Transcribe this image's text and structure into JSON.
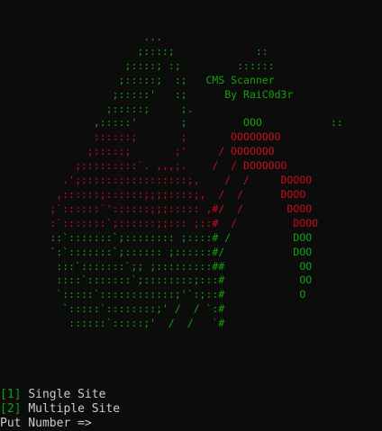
{
  "banner": {
    "title": "CMS Scanner",
    "author": "By RaiC0d3r",
    "art_lines": [
      [
        {
          "c": "g",
          "t": "                       ..."
        }
      ],
      [
        {
          "c": "g",
          "t": "                      ;::::;             ::"
        }
      ],
      [
        {
          "c": "g",
          "t": "                    ;::::; :;         ::::::"
        }
      ],
      [
        {
          "c": "g",
          "t": "                   ;:::::;  :;   "
        },
        {
          "c": "g",
          "t": "CMS Scanner"
        }
      ],
      [
        {
          "c": "g",
          "t": "                  ;:::::'   :;      "
        },
        {
          "c": "g",
          "t": "By RaiC0d3r"
        }
      ],
      [
        {
          "c": "g",
          "t": "                 ;:::::;     ;."
        }
      ],
      [
        {
          "c": "g",
          "t": "               ,:::::'       ;         OOO           ::"
        }
      ],
      [
        {
          "c": "r",
          "t": "               ::::::;       ;       OOOOOOOO"
        }
      ],
      [
        {
          "c": "r",
          "t": "              ;:::::;       ;'     / OOOOOOO"
        }
      ],
      [
        {
          "c": "r",
          "t": "            ;:::::::::`. ,,,;.    /  / DOOOOOO"
        }
      ],
      [
        {
          "c": "r",
          "t": "          .';:::::::::::::::::;,    /  /     DOOOO"
        }
      ],
      [
        {
          "c": "r",
          "t": "         ,::::::;::::::;;;;::::;,  /  /      DOOO"
        }
      ],
      [
        {
          "c": "r",
          "t": "        ;`::::::`'::::::;;;::::: ,#/  /       DOOO"
        }
      ],
      [
        {
          "c": "r",
          "t": "        :`:::::::`;::::::;;::: ;::#  /         DOOO"
        }
      ],
      [
        {
          "c": "g",
          "t": "        ::`:::::::`;:::::::: ;::::# /          DOO"
        }
      ],
      [
        {
          "c": "g",
          "t": "        `:`:::::::`;:::::: ;::::::#/           DOO"
        }
      ],
      [
        {
          "c": "g",
          "t": "         :::`:::::::`;; ;:::::::::##            OO"
        }
      ],
      [
        {
          "c": "g",
          "t": "         ::::`:::::::`;::::::::;:::#            OO"
        }
      ],
      [
        {
          "c": "g",
          "t": "         `:::::`::::::::::::;'`:;::#            O"
        }
      ],
      [
        {
          "c": "g",
          "t": "          `:::::`::::::::;' /  / `:#"
        }
      ],
      [
        {
          "c": "g",
          "t": "           ::::::`:::::;'  /  /   `#"
        }
      ]
    ]
  },
  "menu": {
    "options": [
      {
        "number": "1",
        "label": "Single Site"
      },
      {
        "number": "2",
        "label": "Multiple Site"
      }
    ],
    "prompt": "Put Number => "
  },
  "colors": {
    "background": "#0c0c0c",
    "green": "#13a10e",
    "red": "#c50f1f",
    "text": "#cccccc"
  }
}
